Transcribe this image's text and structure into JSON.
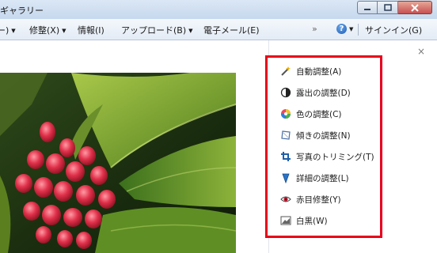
{
  "window": {
    "title": "ギャラリー"
  },
  "menu": [
    {
      "label": "ー)",
      "has_arrow": true
    },
    {
      "label": "修整(X)",
      "has_arrow": true
    },
    {
      "label": "情報(I)",
      "has_arrow": false
    },
    {
      "label": "アップロード(B)",
      "has_arrow": true
    },
    {
      "label": "電子メール(E)",
      "has_arrow": false
    },
    {
      "label": "»",
      "has_arrow": false
    },
    {
      "label": "サインイン(G)",
      "has_arrow": false
    }
  ],
  "panel": {
    "close_label": "×",
    "items": [
      {
        "label": "自動調整(A)",
        "icon": "magic-wand-icon"
      },
      {
        "label": "露出の調整(D)",
        "icon": "exposure-icon"
      },
      {
        "label": "色の調整(C)",
        "icon": "color-wheel-icon"
      },
      {
        "label": "傾きの調整(N)",
        "icon": "straighten-icon"
      },
      {
        "label": "写真のトリミング(T)",
        "icon": "crop-icon"
      },
      {
        "label": "詳細の調整(L)",
        "icon": "sharpen-icon"
      },
      {
        "label": "赤目修整(Y)",
        "icon": "red-eye-icon"
      },
      {
        "label": "白黒(W)",
        "icon": "black-white-icon"
      }
    ],
    "highlight_color": "#e8001b"
  }
}
